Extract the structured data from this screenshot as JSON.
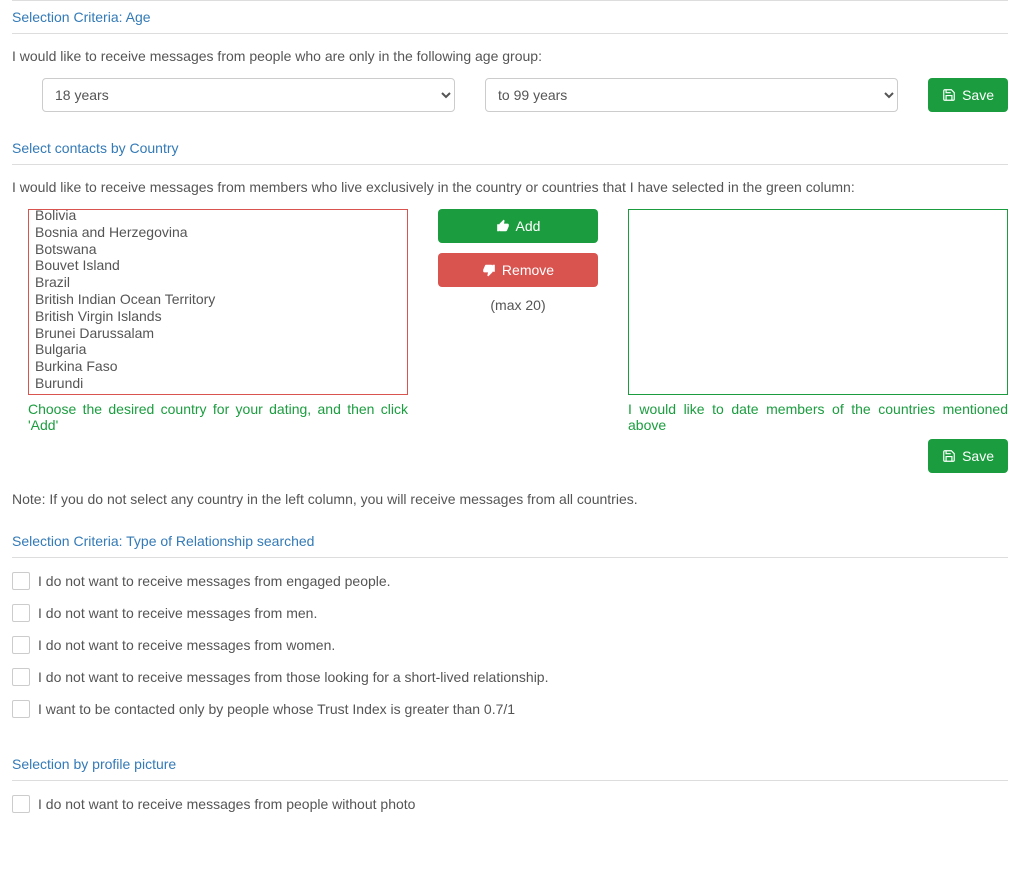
{
  "headers": {
    "age": "Selection Criteria: Age",
    "country": "Select contacts by Country",
    "relationship": "Selection Criteria: Type of Relationship searched",
    "photo": "Selection by profile picture"
  },
  "age": {
    "desc": "I would like to receive messages from people who are only in the following age group:",
    "from": "18 years",
    "to": "to 99 years",
    "save": "Save"
  },
  "country": {
    "desc": "I would like to receive messages from members who live exclusively in the country or countries that I have selected in the green column:",
    "available": [
      "Bolivia",
      "Bosnia and Herzegovina",
      "Botswana",
      "Bouvet Island",
      "Brazil",
      "British Indian Ocean Territory",
      "British Virgin Islands",
      "Brunei Darussalam",
      "Bulgaria",
      "Burkina Faso",
      "Burundi"
    ],
    "hint_left": "Choose the desired country for your dating, and then click 'Add'",
    "hint_right": "I would like to date members of the countries mentioned above",
    "add": "Add",
    "remove": "Remove",
    "max": "(max 20)",
    "save": "Save",
    "note": "Note: If you do not select any country in the left column, you will receive messages from all countries."
  },
  "relationship": {
    "options": [
      "I do not want to receive messages from engaged people.",
      "I do not want to receive messages from men.",
      "I do not want to receive messages from women.",
      "I do not want to receive messages from those looking for a short-lived relationship.",
      "I want to be contacted only by people whose Trust Index is greater than 0.7/1"
    ]
  },
  "photo": {
    "option": "I do not want to receive messages from people without photo"
  }
}
